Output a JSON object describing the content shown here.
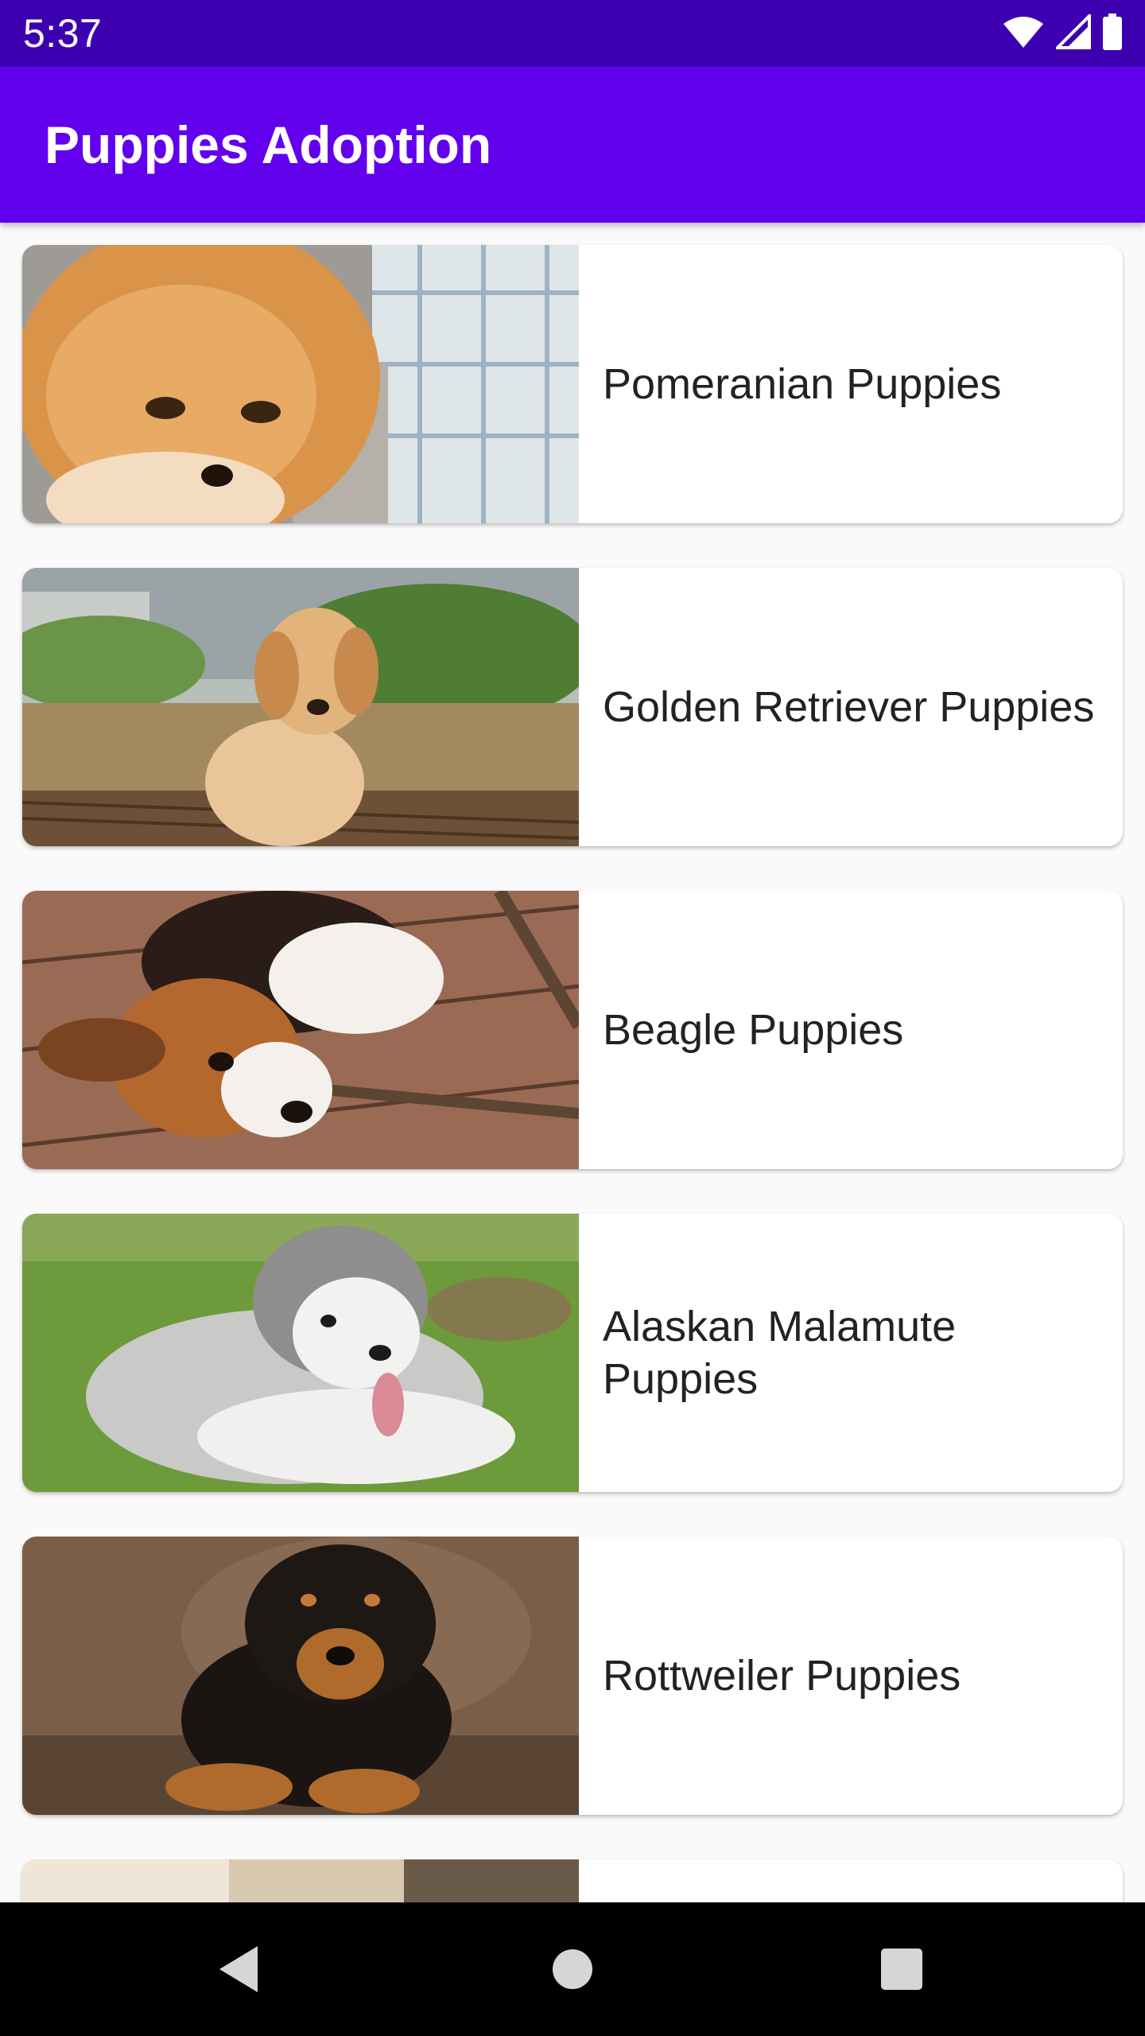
{
  "status_bar": {
    "time": "5:37",
    "icons": [
      "wifi-icon",
      "signal-icon",
      "battery-icon"
    ]
  },
  "app_bar": {
    "title": "Puppies Adoption",
    "background": "#6200ee",
    "status_background": "#3d00b0"
  },
  "puppies": [
    {
      "name": "Pomeranian Puppies",
      "image": "pomeranian-puppy-photo"
    },
    {
      "name": "Golden Retriever Puppies",
      "image": "golden-retriever-puppy-photo"
    },
    {
      "name": "Beagle Puppies",
      "image": "beagle-puppy-photo"
    },
    {
      "name": "Alaskan Malamute Puppies",
      "image": "alaskan-malamute-puppy-photo"
    },
    {
      "name": "Rottweiler Puppies",
      "image": "rottweiler-puppy-photo"
    },
    {
      "name": "",
      "image": "partial-puppy-photo"
    }
  ],
  "nav_bar": {
    "buttons": [
      "back-icon",
      "home-icon",
      "recents-icon"
    ]
  }
}
